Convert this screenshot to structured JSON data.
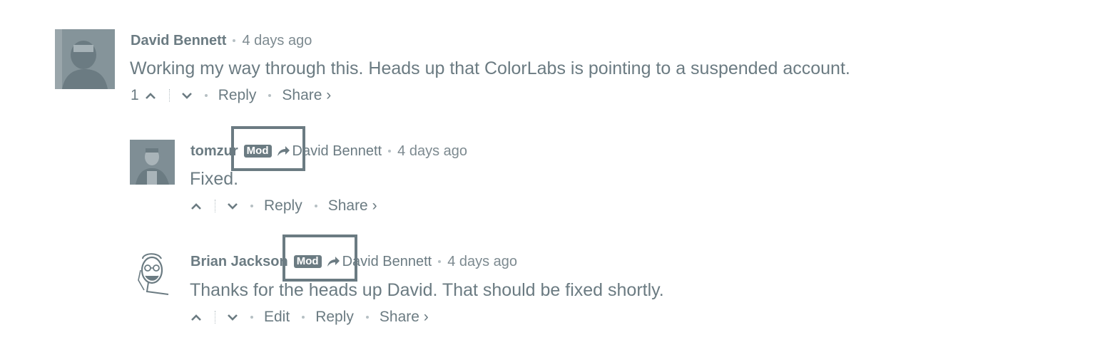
{
  "comments": [
    {
      "author": "David Bennett",
      "time": "4 days ago",
      "text": "Working my way through this. Heads up that ColorLabs is pointing to a suspended account.",
      "vote_count": "1",
      "reply_label": "Reply",
      "share_label": "Share ›"
    },
    {
      "author": "tomzur",
      "badge": "Mod",
      "reply_to": "David Bennett",
      "time": "4 days ago",
      "text": "Fixed.",
      "reply_label": "Reply",
      "share_label": "Share ›"
    },
    {
      "author": "Brian Jackson",
      "badge": "Mod",
      "reply_to": "David Bennett",
      "time": "4 days ago",
      "text": "Thanks for the heads up David. That should be fixed shortly.",
      "edit_label": "Edit",
      "reply_label": "Reply",
      "share_label": "Share ›"
    }
  ],
  "colors": {
    "text": "#6b7b82",
    "muted": "#7d8a90",
    "separator": "#b6c0c4",
    "badge_bg": "#6b7b82"
  },
  "icons": {
    "upvote": "chevron-up-icon",
    "downvote": "chevron-down-icon",
    "reply_to": "share-arrow-icon"
  }
}
